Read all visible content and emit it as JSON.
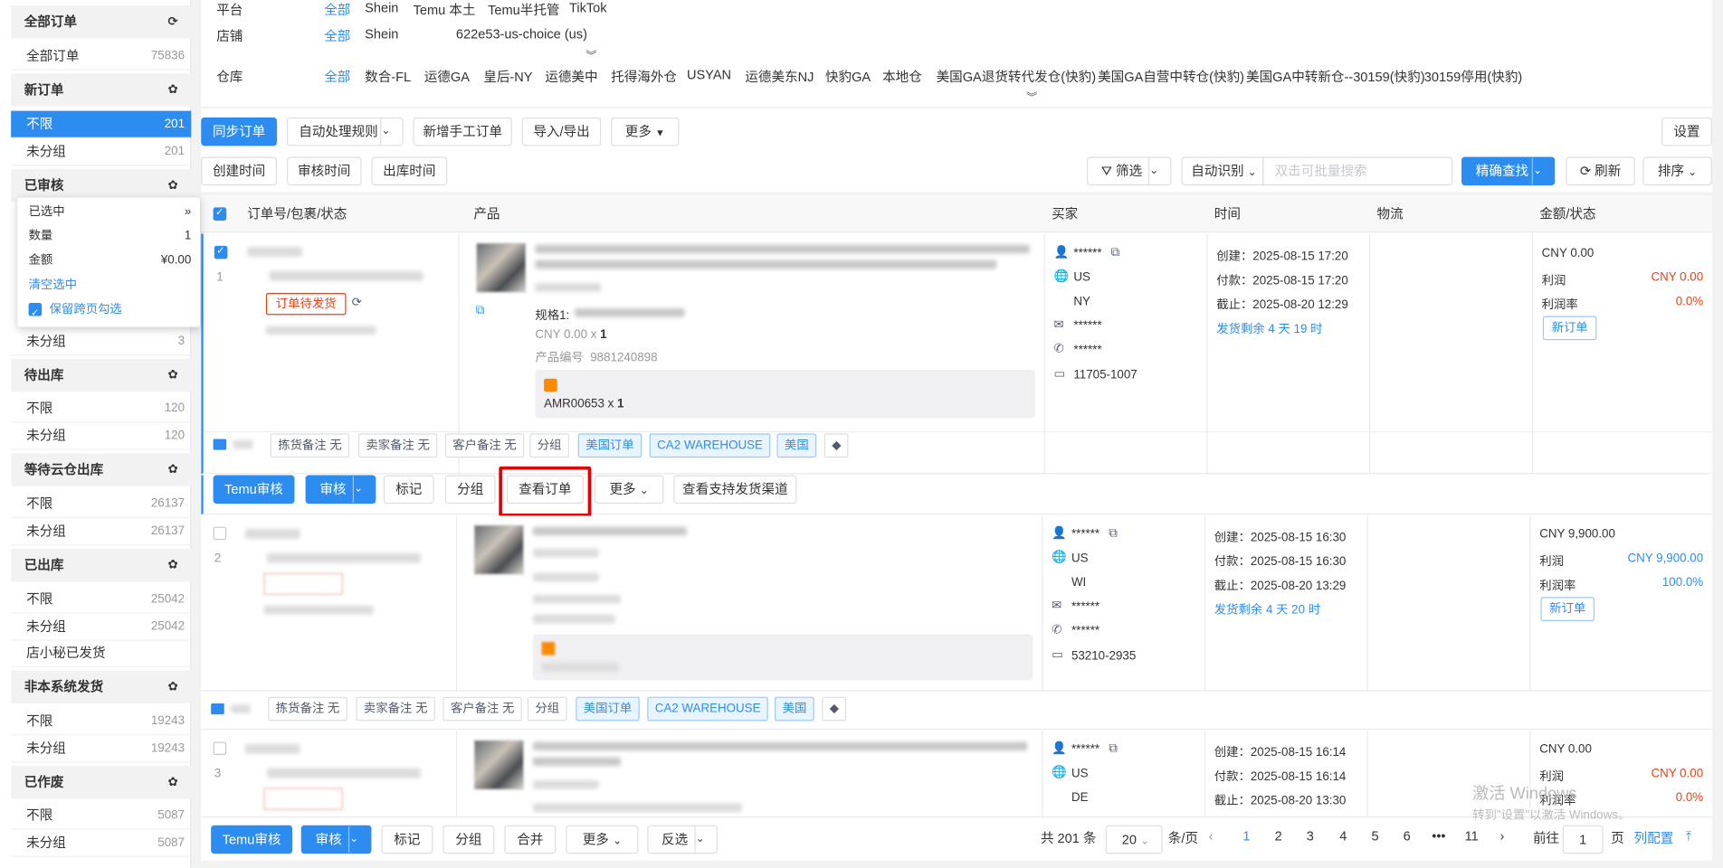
{
  "sidebar": {
    "sections": [
      {
        "title": "全部订单",
        "icon": "refresh-icon",
        "items": [
          {
            "label": "全部订单",
            "count": "75836"
          }
        ]
      },
      {
        "title": "新订单",
        "icon": "gear-icon",
        "items": [
          {
            "label": "不限",
            "count": "201",
            "active": true
          },
          {
            "label": "未分组",
            "count": "201"
          }
        ]
      },
      {
        "title": "已审核",
        "icon": "gear-icon",
        "items": [
          {
            "label": "未分组",
            "count": "3"
          }
        ]
      },
      {
        "title": "待出库",
        "icon": "gear-icon",
        "items": [
          {
            "label": "不限",
            "count": "120"
          },
          {
            "label": "未分组",
            "count": "120"
          }
        ]
      },
      {
        "title": "等待云仓出库",
        "icon": "gear-icon",
        "items": [
          {
            "label": "不限",
            "count": "26137"
          },
          {
            "label": "未分组",
            "count": "26137"
          }
        ]
      },
      {
        "title": "已出库",
        "icon": "gear-icon",
        "items": [
          {
            "label": "不限",
            "count": "25042"
          },
          {
            "label": "未分组",
            "count": "25042"
          },
          {
            "label": "店小秘已发货",
            "count": ""
          }
        ]
      },
      {
        "title": "非本系统发货",
        "icon": "gear-icon",
        "items": [
          {
            "label": "不限",
            "count": "19243"
          },
          {
            "label": "未分组",
            "count": "19243"
          }
        ]
      },
      {
        "title": "已作废",
        "icon": "gear-icon",
        "items": [
          {
            "label": "不限",
            "count": "5087"
          },
          {
            "label": "未分组",
            "count": "5087"
          }
        ]
      }
    ]
  },
  "popup": {
    "selected": "已选中",
    "qty_label": "数量",
    "qty": "1",
    "amount_label": "金额",
    "amount": "¥0.00",
    "clear": "清空选中",
    "keep": "保留跨页勾选"
  },
  "filters": {
    "platform_label": "平台",
    "platforms": [
      "全部",
      "Shein",
      "Temu 本土",
      "Temu半托管",
      "TikTok"
    ],
    "store_label": "店铺",
    "stores": [
      "全部",
      "Shein",
      "622e53-us-choice (us)"
    ],
    "warehouse_label": "仓库",
    "warehouses": [
      "全部",
      "数合-FL",
      "运德GA",
      "皇后-NY",
      "运德美中",
      "托得海外仓",
      "USYAN",
      "运德美东NJ",
      "快豹GA",
      "本地仓",
      "美国GA退货转代发仓(快豹)",
      "美国GA自营中转仓(快豹)",
      "美国GA中转新仓--30159(快豹)",
      "30159停用(快豹)"
    ]
  },
  "toolbar": {
    "sync": "同步订单",
    "auto_rules": "自动处理规则",
    "new_manual": "新增手工订单",
    "import_export": "导入/导出",
    "more": "更多",
    "settings": "设置",
    "create_time": "创建时间",
    "review_time": "审核时间",
    "out_time": "出库时间",
    "filter": "筛选",
    "auto_detect": "自动识别",
    "search_placeholder": "双击可批量搜索",
    "precise": "精确查找",
    "refresh": "刷新",
    "sort": "排序"
  },
  "columns": [
    "订单号/包裹/状态",
    "产品",
    "买家",
    "时间",
    "物流",
    "金额/状态"
  ],
  "orders": [
    {
      "index": "1",
      "status": "订单待发货",
      "spec": "规格1:",
      "price": "CNY 0.00",
      "qty": "1",
      "code_label": "产品编号",
      "code": "9881240898",
      "sku": "AMR00653",
      "sku_qty": "1",
      "buyer": "******",
      "country": "US",
      "state": "NY",
      "email": "******",
      "phone": "******",
      "zip": "11705-1007",
      "created": "创建：2025-08-15 17:20",
      "paid": "付款：2025-08-15 17:20",
      "deadline": "截止：2025-08-20 12:29",
      "remain": "发货剩余 4 天 19 时",
      "amount": "CNY 0.00",
      "profit_label": "利润",
      "profit": "CNY 0.00",
      "rate_label": "利润率",
      "rate": "0.0%",
      "state_tag": "新订单"
    },
    {
      "index": "2",
      "buyer": "******",
      "country": "US",
      "state": "WI",
      "email": "******",
      "phone": "******",
      "zip": "53210-2935",
      "created": "创建：2025-08-15 16:30",
      "paid": "付款：2025-08-15 16:30",
      "deadline": "截止：2025-08-20 13:29",
      "remain": "发货剩余 4 天 20 时",
      "amount": "CNY 9,900.00",
      "profit_label": "利润",
      "profit": "CNY 9,900.00",
      "rate_label": "利润率",
      "rate": "100.0%",
      "state_tag": "新订单"
    },
    {
      "index": "3",
      "buyer": "******",
      "country": "US",
      "state": "DE",
      "created": "创建：2025-08-15 16:14",
      "paid": "付款：2025-08-15 16:14",
      "deadline": "截止：2025-08-20 13:30",
      "amount": "CNY 0.00",
      "profit_label": "利润",
      "profit": "CNY 0.00",
      "rate_label": "利润率",
      "rate": "0.0%"
    }
  ],
  "notes": {
    "pick": "拣货备注 无",
    "seller": "卖家备注 无",
    "customer": "客户备注 无",
    "group": "分组",
    "tag_order": "美国订单",
    "tag_wh": "CA2 WAREHOUSE",
    "tag_country": "美国"
  },
  "actions": {
    "temu_review": "Temu审核",
    "review": "审核",
    "mark": "标记",
    "group": "分组",
    "view_order": "查看订单",
    "more": "更多",
    "view_channels": "查看支持发货渠道"
  },
  "footer": {
    "temu_review": "Temu审核",
    "review": "审核",
    "mark": "标记",
    "group": "分组",
    "merge": "合并",
    "more": "更多",
    "invert": "反选",
    "total": "共 201 条",
    "page_size": "20",
    "per_page": "条/页",
    "pages": [
      "1",
      "2",
      "3",
      "4",
      "5",
      "6",
      "•••",
      "11"
    ],
    "goto": "前往",
    "goto_val": "1",
    "page_unit": "页",
    "col_config": "列配置"
  },
  "watermark": {
    "line1": "激活 Windows",
    "line2": "转到\"设置\"以激活 Windows。"
  },
  "colors": {
    "primary": "#2d8cf0",
    "danger": "#ed4014",
    "highlight": "#e00000"
  }
}
